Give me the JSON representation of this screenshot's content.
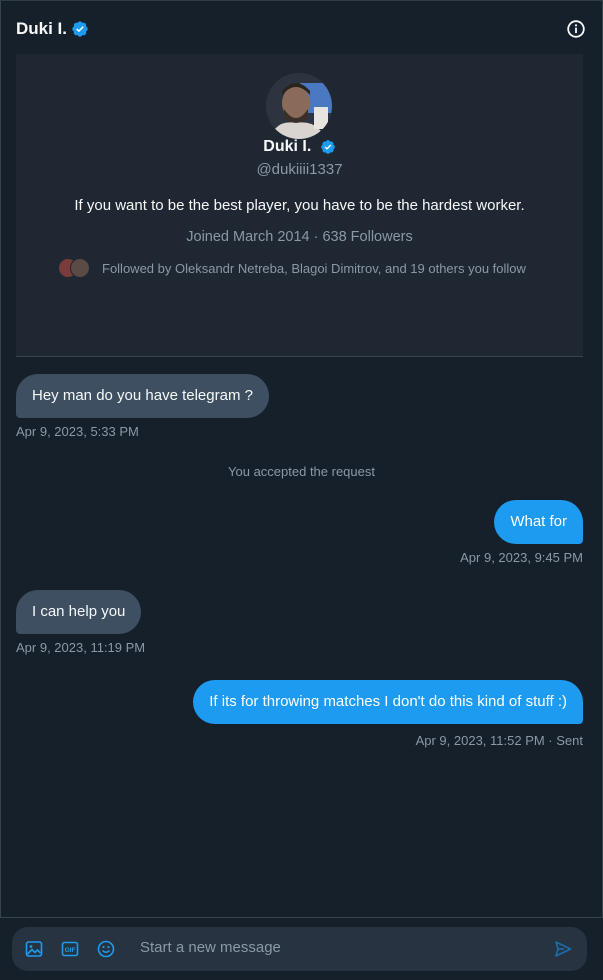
{
  "header": {
    "name": "Duki I.",
    "verified": true
  },
  "profile": {
    "name": "Duki I.",
    "handle": "@dukiiii1337",
    "bio": "If you want to be the best player, you have to be the hardest worker.",
    "joined": "Joined March 2014 · 638 Followers",
    "followed_by": "Followed by Oleksandr Netreba, Blagoi Dimitrov, and 19 others you follow"
  },
  "messages": [
    {
      "direction": "in",
      "text": "Hey man do you have telegram ?",
      "time": "Apr 9, 2023, 5:33 PM"
    },
    {
      "direction": "out",
      "text": "What for",
      "time": "Apr 9, 2023, 9:45 PM"
    },
    {
      "direction": "in",
      "text": "I can help you",
      "time": "Apr 9, 2023, 11:19 PM"
    },
    {
      "direction": "out",
      "text": "If its for throwing matches I don't do this kind of stuff :)",
      "time": "Apr 9, 2023, 11:52 PM · Sent"
    }
  ],
  "system_notice": "You accepted the request",
  "composer": {
    "placeholder": "Start a new message"
  },
  "colors": {
    "accent": "#1d9bf0",
    "background": "#15202b",
    "incoming_bubble": "#3d4f60"
  },
  "icons": [
    "verified-badge-icon",
    "info-icon",
    "image-icon",
    "gif-icon",
    "emoji-icon",
    "send-icon"
  ]
}
